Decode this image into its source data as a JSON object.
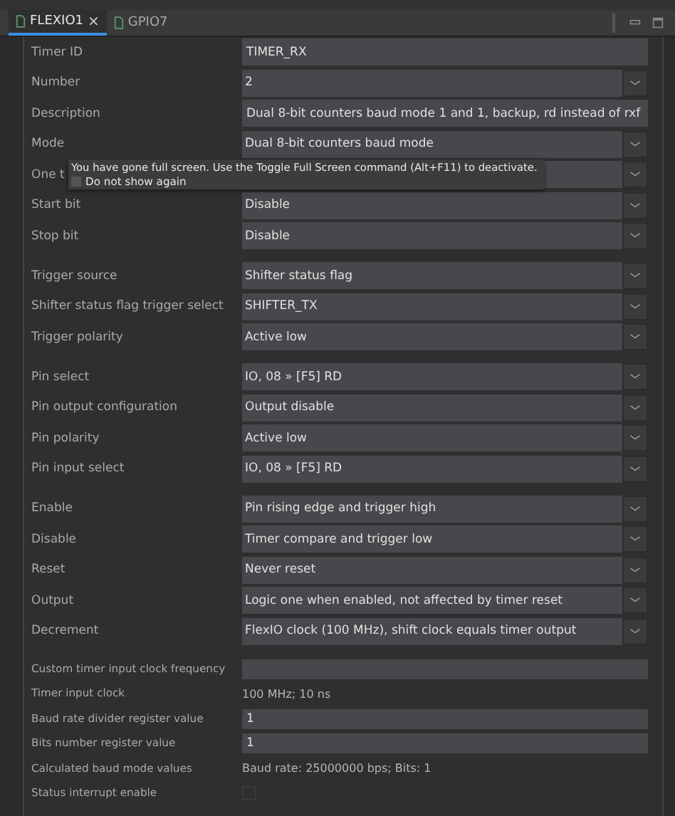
{
  "tabs": [
    {
      "label": "FLEXIO1",
      "selected": true,
      "close": "×"
    },
    {
      "label": "GPIO7",
      "selected": false
    }
  ],
  "groups": [
    [
      {
        "kind": "text",
        "label": "Timer ID",
        "value": "TIMER_RX"
      },
      {
        "kind": "select",
        "label": "Number",
        "value": "2"
      },
      {
        "kind": "text",
        "label": "Description",
        "value": "Dual 8-bit counters baud mode 1 and 1, backup, rd instead of rxf"
      },
      {
        "kind": "select",
        "label": "Mode",
        "value": "Dual 8-bit counters baud mode"
      },
      {
        "kind": "select",
        "label": "One t"
      },
      {
        "kind": "select",
        "label": "Start bit",
        "value": "Disable"
      },
      {
        "kind": "select",
        "label": "Stop bit",
        "value": "Disable"
      }
    ],
    [
      {
        "kind": "select",
        "label": "Trigger source",
        "value": "Shifter status flag"
      },
      {
        "kind": "select",
        "label": "Shifter status flag trigger select",
        "value": "SHIFTER_TX"
      },
      {
        "kind": "select",
        "label": "Trigger polarity",
        "value": "Active low"
      }
    ],
    [
      {
        "kind": "select",
        "label": "Pin select",
        "value": "IO, 08 » [F5] RD"
      },
      {
        "kind": "select",
        "label": "Pin output configuration",
        "value": "Output disable"
      },
      {
        "kind": "select",
        "label": "Pin polarity",
        "value": "Active low"
      },
      {
        "kind": "select",
        "label": "Pin input select",
        "value": "IO, 08 » [F5] RD"
      }
    ],
    [
      {
        "kind": "select",
        "label": "Enable",
        "value": "Pin rising edge and trigger high"
      },
      {
        "kind": "select",
        "label": "Disable",
        "value": "Timer compare and trigger low"
      },
      {
        "kind": "select",
        "label": "Reset",
        "value": "Never reset"
      },
      {
        "kind": "select",
        "label": "Output",
        "value": "Logic one when enabled, not affected by timer reset"
      },
      {
        "kind": "select",
        "label": "Decrement",
        "value": "FlexIO clock (100 MHz), shift clock equals timer output"
      }
    ],
    [
      {
        "kind": "text",
        "label": "Custom timer input clock frequency"
      },
      {
        "kind": "info",
        "label": "Timer input clock",
        "value": "100 MHz; 10 ns"
      },
      {
        "kind": "text",
        "label": "Baud rate divider register value",
        "value": "1"
      },
      {
        "kind": "text",
        "label": "Bits number register value",
        "value": "1"
      },
      {
        "kind": "info",
        "label": "Calculated baud mode values",
        "value": "Baud rate: 25000000 bps; Bits: 1"
      },
      {
        "kind": "checkbox",
        "label": "Status interrupt enable",
        "checked": false
      }
    ]
  ],
  "tooltip": {
    "message": "You have gone full screen. Use the Toggle Full Screen command (Alt+F11) to deactivate.",
    "checkbox": {
      "label": "Do not show again",
      "checked": false
    }
  }
}
